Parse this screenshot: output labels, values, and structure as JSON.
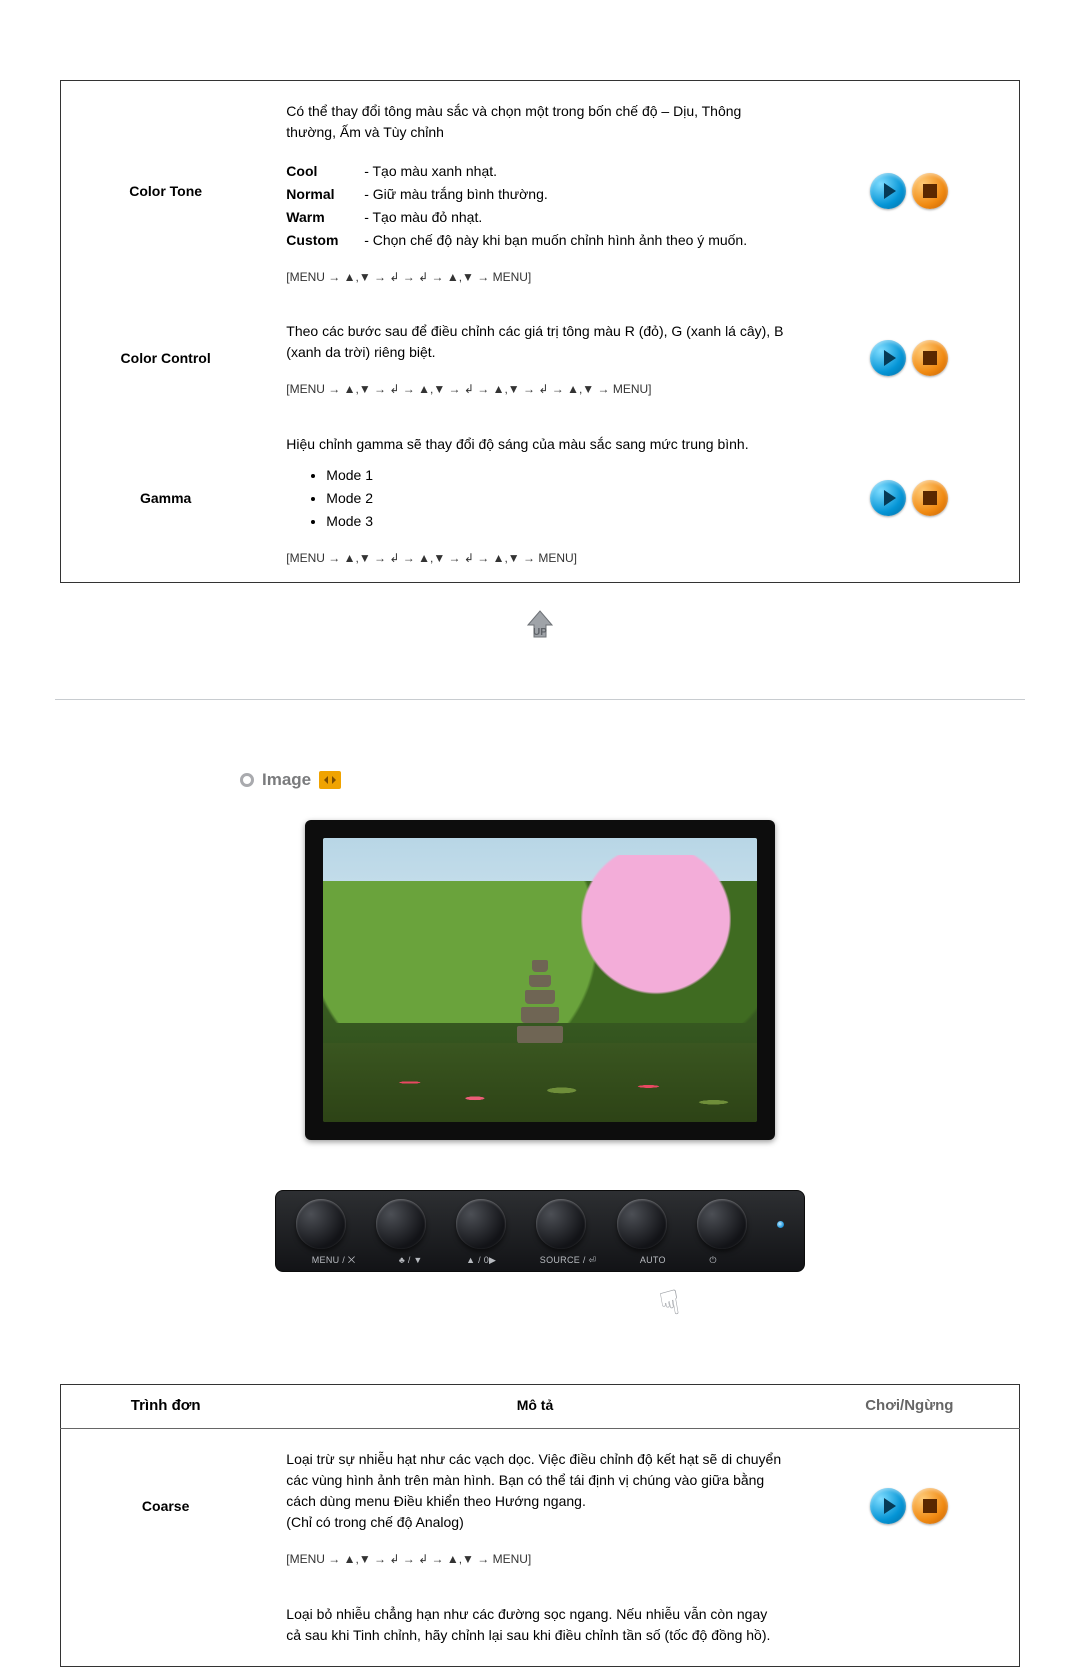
{
  "colors": {
    "play": "#0595d6",
    "stop": "#f08a12",
    "heading": "#7a7b7d",
    "chip": "#f0a300"
  },
  "table_color": {
    "rows": {
      "color_tone": {
        "label": "Color Tone",
        "intro": "Có thể thay đổi tông màu sắc và chọn một trong bốn chế độ – Dịu, Thông thường, Ấm và Tùy chỉnh",
        "options": {
          "cool": {
            "key": "Cool",
            "text": "- Tạo màu xanh nhạt."
          },
          "normal": {
            "key": "Normal",
            "text": "- Giữ màu trắng bình thường."
          },
          "warm": {
            "key": "Warm",
            "text": "- Tạo màu đỏ nhạt."
          },
          "custom": {
            "key": "Custom",
            "text": "- Chọn chế độ này khi bạn muốn chỉnh hình ảnh theo ý muốn."
          }
        },
        "path": "[MENU → ▲,▼ → ↲ → ↲ → ▲,▼ → MENU]"
      },
      "color_control": {
        "label": "Color Control",
        "desc": "Theo các bước sau để điều chỉnh các giá trị tông màu R (đỏ), G (xanh lá cây), B (xanh da trời) riêng biệt.",
        "path": "[MENU → ▲,▼ → ↲ → ▲,▼ → ↲ → ▲,▼ → ↲ → ▲,▼ → MENU]"
      },
      "gamma": {
        "label": "Gamma",
        "desc": "Hiệu chỉnh gamma sẽ thay đổi độ sáng của màu sắc sang mức trung bình.",
        "modes": {
          "mode1": "Mode 1",
          "mode2": "Mode 2",
          "mode3": "Mode 3"
        },
        "path": "[MENU → ▲,▼ → ↲ → ▲,▼ → ↲ → ▲,▼ → MENU]"
      }
    }
  },
  "up_label": "UP",
  "image_section": {
    "title": "Image"
  },
  "bezel": {
    "labels": {
      "menu": "MENU / ⨉",
      "minus": "♣ / ▼",
      "plus": "▲ / 0▶",
      "source": "SOURCE / ⏎",
      "auto": "AUTO",
      "power": "⏻"
    }
  },
  "table_image": {
    "headers": {
      "menu": "Trình đơn",
      "desc": "Mô tả",
      "play": "Chơi/Ngừng"
    },
    "rows": {
      "coarse": {
        "label": "Coarse",
        "desc": "Loại trừ sự nhiễu hạt như các vạch dọc. Việc điều chỉnh độ kết hạt sẽ di chuyển các vùng hình ảnh trên màn hình. Bạn có thể tái định vị chúng vào giữa bằng cách dùng menu Điều khiển theo Hướng ngang.\n(Chỉ có trong chế độ Analog)",
        "path": "[MENU → ▲,▼ → ↲ → ↲ → ▲,▼ → MENU]"
      },
      "fine_preview": {
        "desc": "Loại bỏ nhiễu chẳng hạn như các đường sọc ngang. Nếu nhiễu vẫn còn ngay cả sau khi Tinh chỉnh, hãy chỉnh lại sau khi điều chỉnh tần số (tốc độ đồng hồ)."
      }
    }
  }
}
